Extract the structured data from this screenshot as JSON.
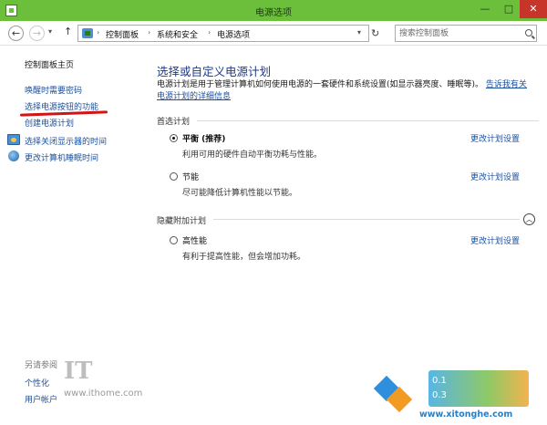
{
  "window": {
    "title": "电源选项",
    "minimize": "—",
    "maximize": "□",
    "close": "✕"
  },
  "nav": {
    "back": "←",
    "forward": "→",
    "up": "↑",
    "breadcrumb": [
      "控制面板",
      "系统和安全",
      "电源选项"
    ],
    "search_placeholder": "搜索控制面板"
  },
  "sidebar": {
    "home": "控制面板主页",
    "items": [
      {
        "label": "唤醒时需要密码"
      },
      {
        "label": "选择电源按钮的功能"
      },
      {
        "label": "创建电源计划"
      },
      {
        "label": "选择关闭显示器的时间",
        "icon": "monitor-icon"
      },
      {
        "label": "更改计算机睡眠时间",
        "icon": "globe-icon"
      }
    ],
    "see_also": "另请参阅",
    "see_also_items": [
      "个性化",
      "用户帐户"
    ]
  },
  "main": {
    "title": "选择或自定义电源计划",
    "description": "电源计划是用于管理计算机如何使用电源的一套硬件和系统设置(如显示器亮度、睡眠等)。",
    "description_link": "告诉我有关电源计划的详细信息",
    "preferred_label": "首选计划",
    "hidden_label": "隐藏附加计划",
    "change_link": "更改计划设置",
    "plans": [
      {
        "name": "平衡 (推荐)",
        "desc": "利用可用的硬件自动平衡功耗与性能。",
        "selected": true
      },
      {
        "name": "节能",
        "desc": "尽可能降低计算机性能以节能。",
        "selected": false
      },
      {
        "name": "高性能",
        "desc": "有利于提高性能，但会增加功耗。",
        "selected": false
      }
    ]
  },
  "watermarks": {
    "ithome_logo": "IT",
    "ithome_url": "www.ithome.com",
    "xitonghe_url": "www.xitonghe.com",
    "speed_1": "0.1",
    "speed_2": "0.3"
  },
  "colors": {
    "titlebar": "#6bbf3b",
    "link": "#1c4f9c",
    "title_blue": "#1e3b8a",
    "annotation_red": "#d41414"
  }
}
